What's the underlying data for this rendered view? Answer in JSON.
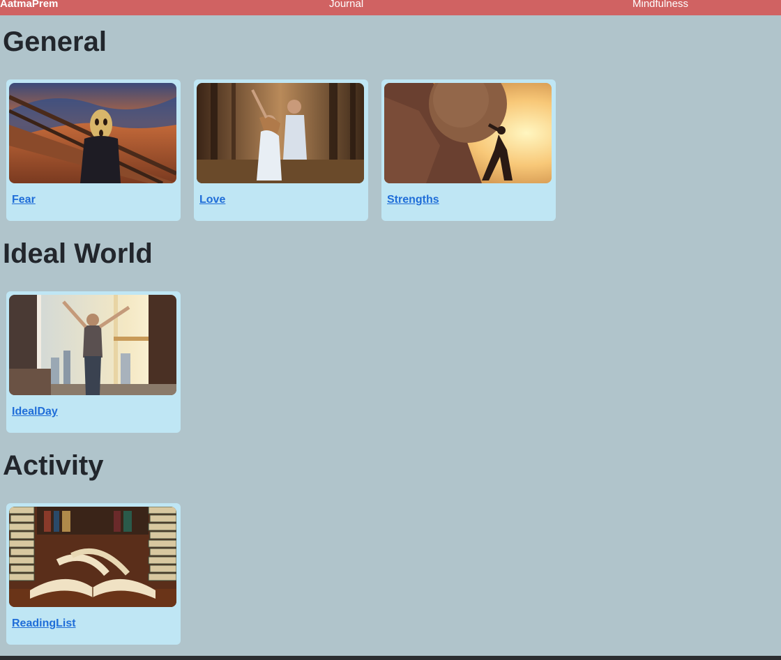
{
  "header": {
    "brand": "AatmaPrem",
    "nav": [
      "Journal",
      "Mindfulness"
    ]
  },
  "sections": [
    {
      "title": "General",
      "cards": [
        {
          "label": "Fear",
          "image": "scream-painting"
        },
        {
          "label": "Love",
          "image": "dancing-couple"
        },
        {
          "label": "Strengths",
          "image": "sisyphus-boulder"
        }
      ]
    },
    {
      "title": "Ideal World",
      "cards": [
        {
          "label": "IdealDay",
          "image": "woman-at-window"
        }
      ]
    },
    {
      "title": "Activity",
      "cards": [
        {
          "label": "ReadingList",
          "image": "open-books"
        }
      ]
    }
  ],
  "colors": {
    "header_bg": "#d06262",
    "page_bg": "#b0c4cb",
    "card_bg": "#bfe6f4",
    "link": "#1f6dd8",
    "heading": "#22262c"
  }
}
